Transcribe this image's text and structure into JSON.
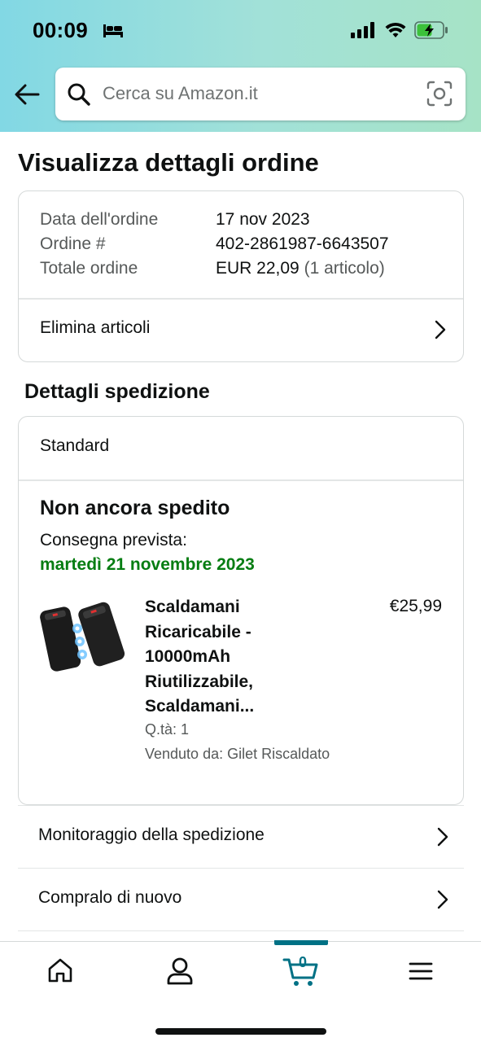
{
  "status_bar": {
    "time": "00:09"
  },
  "search": {
    "placeholder": "Cerca su Amazon.it"
  },
  "page": {
    "title": "Visualizza dettagli ordine"
  },
  "order": {
    "date_label": "Data dell'ordine",
    "date_value": "17 nov 2023",
    "number_label": "Ordine #",
    "number_value": "402-2861987-6643507",
    "total_label": "Totale ordine",
    "total_value": "EUR 22,09",
    "total_items": "(1 articolo)",
    "delete_items_label": "Elimina articoli"
  },
  "shipment": {
    "section_title": "Dettagli spedizione",
    "method": "Standard",
    "status": "Non ancora spedito",
    "delivery_label": "Consegna prevista:",
    "delivery_date": "martedì 21 novembre 2023",
    "delivery_date_color": "#067d12",
    "product": {
      "name": "Scaldamani Ricaricabile - 10000mAh Riutilizzabile, Scaldamani...",
      "price": "€25,99",
      "quantity": "Q.tà: 1",
      "seller": "Venduto da: Gilet Riscaldato"
    }
  },
  "actions": {
    "track_label": "Monitoraggio della spedizione",
    "buy_again_label": "Compralo di nuovo"
  },
  "bottom_nav": {
    "items": [
      "home-icon",
      "account-icon",
      "cart-icon",
      "menu-icon"
    ],
    "cart_count": "0",
    "accent_color": "#007185"
  }
}
